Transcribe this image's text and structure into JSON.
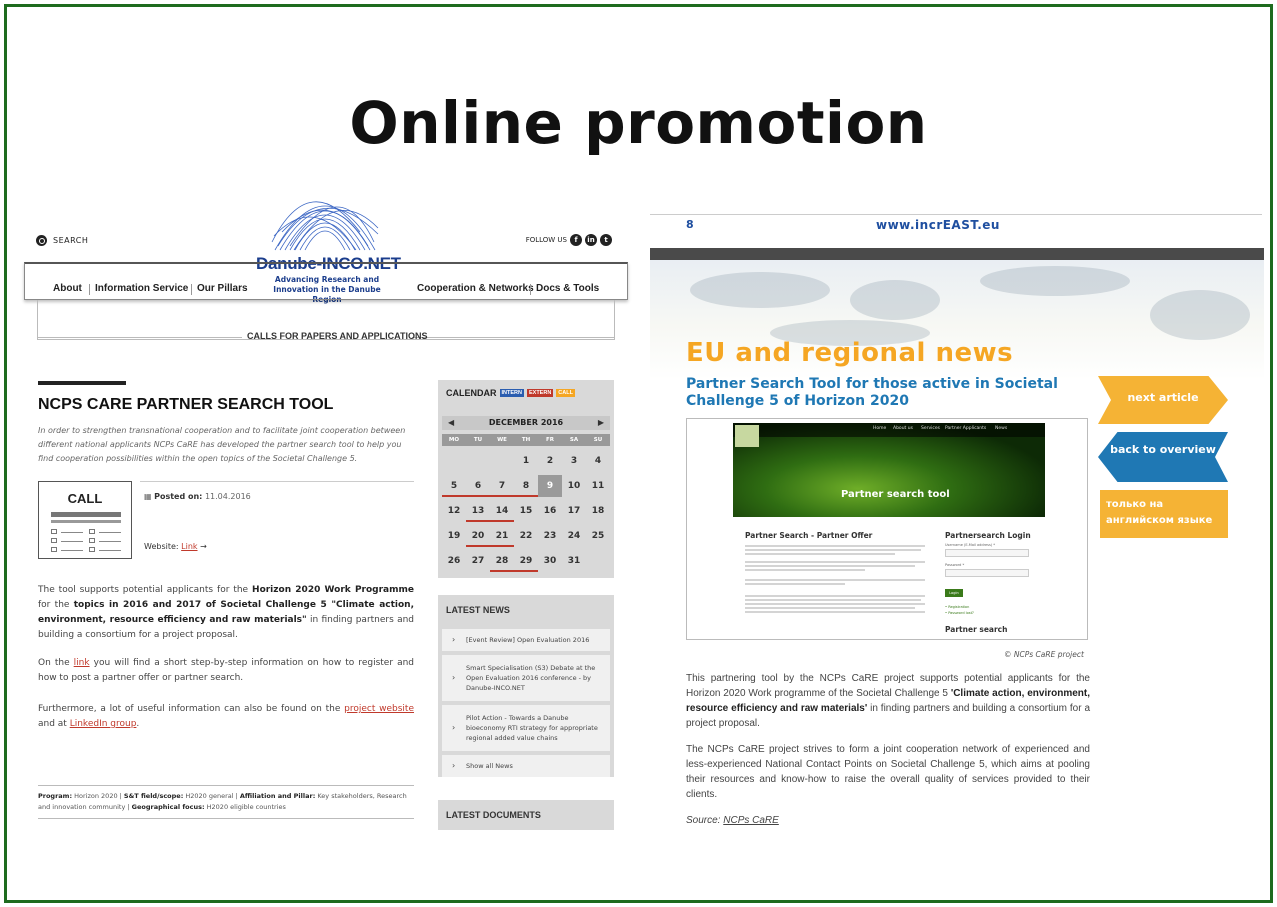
{
  "slide": {
    "title": "Online promotion"
  },
  "danube": {
    "search_label": "SEARCH",
    "follow_label": "FOLLOW US",
    "logo_name": "Danube-INCO.NET",
    "logo_sub": "Advancing Research and Innovation in the Danube Region",
    "nav": [
      "About",
      "Information Service",
      "Our Pillars",
      "Cooperation & Networks",
      "Docs & Tools"
    ],
    "section_label": "CALLS FOR PAPERS AND APPLICATIONS",
    "article": {
      "title": "NCPS CARE PARTNER SEARCH TOOL",
      "intro": "In order to strengthen transnational cooperation and to facilitate joint cooperation between different national applicants NCPs CaRE has developed the partner search tool to help you find cooperation possibilities within the open topics of the Societal Challenge 5.",
      "call_label": "CALL",
      "posted_label": "Posted on:",
      "posted_date": "11.04.2016",
      "website_label": "Website:",
      "website_link": "Link",
      "p1_a": "The tool supports potential applicants for the ",
      "p1_b": "Horizon 2020 Work Programme",
      "p1_c": " for the ",
      "p1_d": "topics in 2016 and 2017 of Societal Challenge 5 \"Climate action, environment, resource efficiency and raw materials\"",
      "p1_e": " in finding partners and building a consortium for a project proposal.",
      "p2_a": "On the ",
      "p2_link": "link",
      "p2_b": " you will find a short step-by-step information on how to register and how to post a partner offer or partner search.",
      "p3_a": "Furthermore, a lot of useful information can also be found on the ",
      "p3_link1": "project website",
      "p3_b": " and at ",
      "p3_link2": "LinkedIn group",
      "p3_c": ".",
      "prog_label": "Program:",
      "prog_value": " Horizon 2020 | ",
      "scope_label": "S&T field/scope:",
      "scope_value": " H2020 general | ",
      "aff_label": "Affiliation and Pillar:",
      "aff_value": " Key stakeholders, Research and innovation community | ",
      "geo_label": "Geographical focus:",
      "geo_value": " H2020 eligible countries"
    },
    "calendar": {
      "title": "CALENDAR",
      "tags": [
        {
          "label": "INTERN",
          "color": "#2a5db0"
        },
        {
          "label": "EXTERN",
          "color": "#c0392b"
        },
        {
          "label": "CALL",
          "color": "#f5a623"
        }
      ],
      "month": "DECEMBER 2016",
      "prev": "◀",
      "next": "▶",
      "dow": [
        "MO",
        "TU",
        "WE",
        "TH",
        "FR",
        "SA",
        "SU"
      ],
      "weeks": [
        [
          "",
          "",
          "",
          "1",
          "2",
          "3",
          "4"
        ],
        [
          "5",
          "6",
          "7",
          "8",
          "9",
          "10",
          "11"
        ],
        [
          "12",
          "13",
          "14",
          "15",
          "16",
          "17",
          "18"
        ],
        [
          "19",
          "20",
          "21",
          "22",
          "23",
          "24",
          "25"
        ],
        [
          "26",
          "27",
          "28",
          "29",
          "30",
          "31",
          ""
        ]
      ]
    },
    "latest_news": {
      "title": "LATEST NEWS",
      "items": [
        "[Event Review] Open Evaluation 2016",
        "Smart Specialisation (S3) Debate at the Open Evaluation 2016 conference - by Danube-INCO.NET",
        "Pilot Action - Towards a Danube bioeconomy RTI strategy for appropriate regional added value chains",
        "Show all News"
      ]
    },
    "latest_docs": {
      "title": "LATEST DOCUMENTS"
    }
  },
  "increast": {
    "page_number": "8",
    "url": "www.incrEAST.eu",
    "headline": "EU and regional news",
    "subheadline": "Partner Search Tool for those active in Societal Challenge 5 of Horizon 2020",
    "next_article": "next article",
    "back_overview": "back to overview",
    "russian_note": "только на английском языке",
    "pst": {
      "nav": [
        "Home",
        "About us",
        "Services",
        "Partner Applicants",
        "News"
      ],
      "hero_title": "Partner search tool",
      "offer_title": "Partner Search - Partner Offer",
      "login_title": "Partnersearch Login",
      "username_label": "Username (E-Mail address) *",
      "password_label": "Password *",
      "login_btn": "Login",
      "register": "Registration",
      "forgot": "Password lost?",
      "search_title": "Partner search"
    },
    "credit": "© NCPs CaRE project",
    "p1_a": "This partnering tool by the NCPs CaRE project supports potential applicants for the Horizon 2020 Work programme of the Societal Challenge 5 ",
    "p1_b": "'Climate action, environment, resource efficiency and raw materials'",
    "p1_c": " in finding partners and building a consortium for a project proposal.",
    "p2": "The NCPs CaRE project strives to form a joint cooperation network of experienced and less-experienced National Contact Points on Societal Challenge 5, which aims at pooling their resources and know-how to raise the overall quality of services provided to their clients.",
    "source_label": "Source: ",
    "source_link": "NCPs CaRE"
  }
}
